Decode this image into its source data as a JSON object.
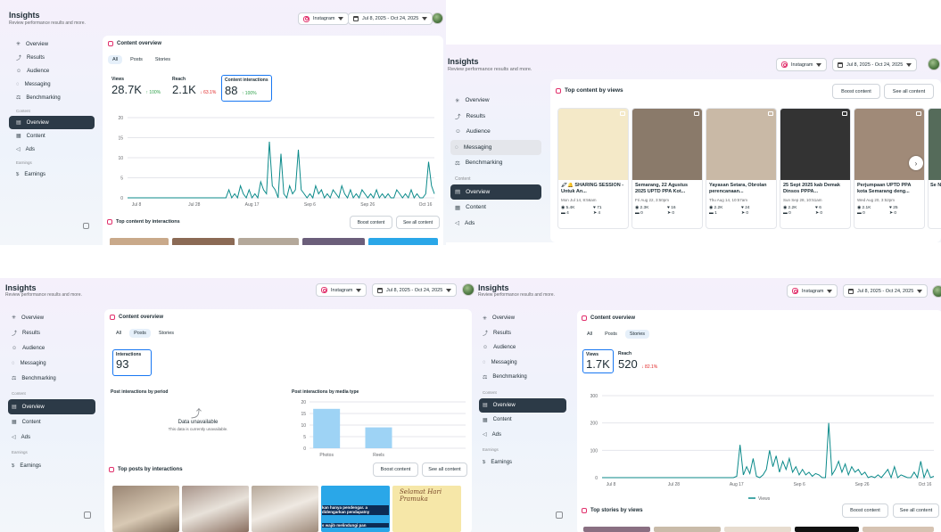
{
  "header": {
    "title": "Insights",
    "subtitle": "Review performance results and more.",
    "platform": "Instagram",
    "date_range": "Jul 8, 2025 - Oct 24, 2025"
  },
  "nav": {
    "items": [
      "Overview",
      "Results",
      "Audience",
      "Messaging",
      "Benchmarking"
    ],
    "content_section": "Content",
    "content_items": [
      "Overview",
      "Content",
      "Ads"
    ],
    "earnings_section": "Earnings",
    "earnings_items": [
      "Earnings"
    ]
  },
  "content_overview": {
    "title": "Content overview",
    "tabs": [
      "All",
      "Posts",
      "Stories"
    ]
  },
  "panel_a": {
    "metrics": [
      {
        "label": "Views",
        "value": "28.7K",
        "delta": "↑ 100%",
        "dir": "up"
      },
      {
        "label": "Reach",
        "value": "2.1K",
        "delta": "↓ 63.1%",
        "dir": "down"
      },
      {
        "label": "Content interactions",
        "value": "88",
        "delta": "↑ 100%",
        "dir": "up"
      }
    ],
    "top_title": "Top content by interactions",
    "boost": "Boost content",
    "see_all": "See all content"
  },
  "panel_b": {
    "top_title": "Top content by views",
    "boost": "Boost content",
    "see_all": "See all content",
    "posts": [
      {
        "title": "🖍🔔 SHARING SESSION - Untuk An...",
        "date": "Mon Jul 14, 8:56am",
        "views": "5.4K",
        "likes": "71",
        "comments": "4",
        "shares": "4",
        "color": "#f4e9c8"
      },
      {
        "title": "Semarang, 22 Agustus 2025 UPTD PPA Kot...",
        "date": "Fri Aug 22, 3:50pm",
        "views": "2.3K",
        "likes": "16",
        "comments": "0",
        "shares": "0",
        "color": "#8a7a6a"
      },
      {
        "title": "Yayasan Setara, Obrolan perencanaan...",
        "date": "Thu Aug 14, 10:57am",
        "views": "2.2K",
        "likes": "24",
        "comments": "1",
        "shares": "0",
        "color": "#c9b9a6"
      },
      {
        "title": "25 Sept 2025 kab Demak Dinsos PPPA...",
        "date": "Sun Sep 28, 10:51am",
        "views": "2.2K",
        "likes": "6",
        "comments": "0",
        "shares": "0",
        "color": "#333333"
      },
      {
        "title": "Perjumpaan UPTD PPA kota Semarang deng...",
        "date": "Wed Aug 20, 3:52pm",
        "views": "2.1K",
        "likes": "25",
        "comments": "0",
        "shares": "0",
        "color": "#a08a78"
      }
    ],
    "partial_title": "Se N"
  },
  "panel_c": {
    "metric": {
      "label": "Interactions",
      "value": "93"
    },
    "period_title": "Post interactions by period",
    "unavailable": "Data unavailable",
    "unavailable_sub": "This data is currently unavailable.",
    "media_title": "Post interactions by media type",
    "top_title": "Top posts by interactions",
    "boost": "Boost content",
    "see_all": "See all content",
    "thumb_text_1": "kan hanya pendengar. a didengarkan pendapatny",
    "thumb_text_2": "s wajib melindungi pan",
    "thumb_text_3": "Selamat Hari Pramuka"
  },
  "panel_d": {
    "metrics": [
      {
        "label": "Views",
        "value": "1.7K",
        "delta": "",
        "dir": "up"
      },
      {
        "label": "Reach",
        "value": "520",
        "delta": "↓ 82.1%",
        "dir": "down"
      }
    ],
    "legend": "Views",
    "top_title": "Top stories by views",
    "boost": "Boost content",
    "see_all": "See all content"
  },
  "chart_data": [
    {
      "type": "line",
      "title": "",
      "x_ticks": [
        "Jul 8",
        "Jul 28",
        "Aug 17",
        "Sep 6",
        "Sep 26",
        "Oct 16"
      ],
      "ylim": [
        0,
        20
      ],
      "y_ticks": [
        0,
        5,
        10,
        15,
        20
      ],
      "color": "#0b8a8a",
      "grid": true,
      "series": [
        {
          "values": [
            0,
            0,
            0,
            0,
            0,
            0,
            0,
            0,
            0,
            0,
            0,
            0,
            0,
            0,
            0,
            0,
            0,
            0,
            0,
            0,
            0,
            0,
            0,
            0,
            0,
            0,
            0,
            0,
            0,
            0,
            0,
            0,
            0,
            0,
            0,
            2,
            0,
            1,
            0,
            3,
            1,
            0,
            2,
            0,
            1,
            0,
            4,
            2,
            1,
            14,
            3,
            2,
            0,
            11,
            1,
            0,
            3,
            1,
            2,
            12,
            2,
            1,
            0,
            1,
            0,
            3,
            1,
            2,
            0,
            1,
            0,
            2,
            1,
            0,
            3,
            1,
            0,
            2,
            0,
            1,
            0,
            2,
            1,
            0,
            1,
            0,
            2,
            0,
            1,
            0,
            1,
            0,
            0,
            2,
            1,
            0,
            1,
            0,
            2,
            0,
            1,
            0,
            0,
            1,
            9,
            3,
            1
          ]
        }
      ]
    },
    {
      "type": "bar",
      "title": "Post interactions by media type",
      "categories": [
        "Photos",
        "Reels"
      ],
      "values": [
        17,
        9
      ],
      "ylim": [
        0,
        20
      ],
      "y_ticks": [
        0,
        5,
        10,
        15,
        20
      ],
      "color": "#9ed3f5",
      "grid": true
    },
    {
      "type": "line",
      "title": "",
      "x_ticks": [
        "Jul 8",
        "Jul 28",
        "Aug 17",
        "Sep 6",
        "Sep 26",
        "Oct 16"
      ],
      "ylim": [
        0,
        300
      ],
      "y_ticks": [
        0,
        100,
        200,
        300
      ],
      "color": "#0b8a8a",
      "legend": "top-none",
      "grid": true,
      "series": [
        {
          "name": "Views",
          "values": [
            0,
            0,
            0,
            0,
            0,
            0,
            0,
            0,
            0,
            0,
            0,
            0,
            0,
            0,
            0,
            0,
            0,
            0,
            0,
            0,
            0,
            0,
            0,
            0,
            0,
            0,
            0,
            0,
            0,
            0,
            0,
            0,
            0,
            0,
            0,
            0,
            0,
            0,
            0,
            0,
            0,
            5,
            120,
            10,
            40,
            15,
            70,
            5,
            0,
            10,
            30,
            100,
            40,
            80,
            20,
            60,
            30,
            70,
            20,
            40,
            10,
            30,
            10,
            20,
            5,
            15,
            10,
            0,
            0,
            200,
            10,
            30,
            60,
            20,
            50,
            10,
            40,
            20,
            30,
            10,
            20,
            0,
            5,
            0,
            10,
            0,
            15,
            30,
            0,
            40,
            0,
            10,
            5,
            0,
            0,
            20,
            0,
            60,
            0,
            30,
            0,
            5
          ]
        }
      ]
    }
  ]
}
